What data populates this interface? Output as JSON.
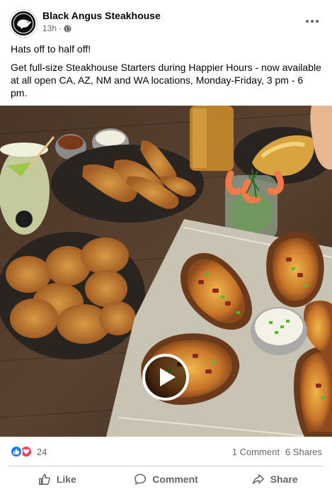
{
  "post": {
    "page_name": "Black Angus Steakhouse",
    "timestamp": "13h",
    "separator": "·",
    "privacy_icon": "globe-icon",
    "more_icon": "more-options-icon",
    "headline": "Hats off to half off!",
    "body": "Get full-size Steakhouse Starters during Happier Hours - now available at all open CA, AZ, NM and WA locations, Monday-Friday, 3 pm - 6 pm.",
    "media": {
      "type": "video",
      "play_icon": "play-icon"
    },
    "stats": {
      "reaction_icons": [
        "like-icon",
        "love-icon"
      ],
      "reaction_count": "24",
      "comments": "1 Comment",
      "shares": "6 Shares"
    },
    "actions": {
      "like": "Like",
      "comment": "Comment",
      "share": "Share"
    }
  },
  "colors": {
    "brand_blue": "#1877f2",
    "love_red": "#f33e58",
    "secondary_text": "#65676b",
    "divider": "#ced0d4"
  }
}
